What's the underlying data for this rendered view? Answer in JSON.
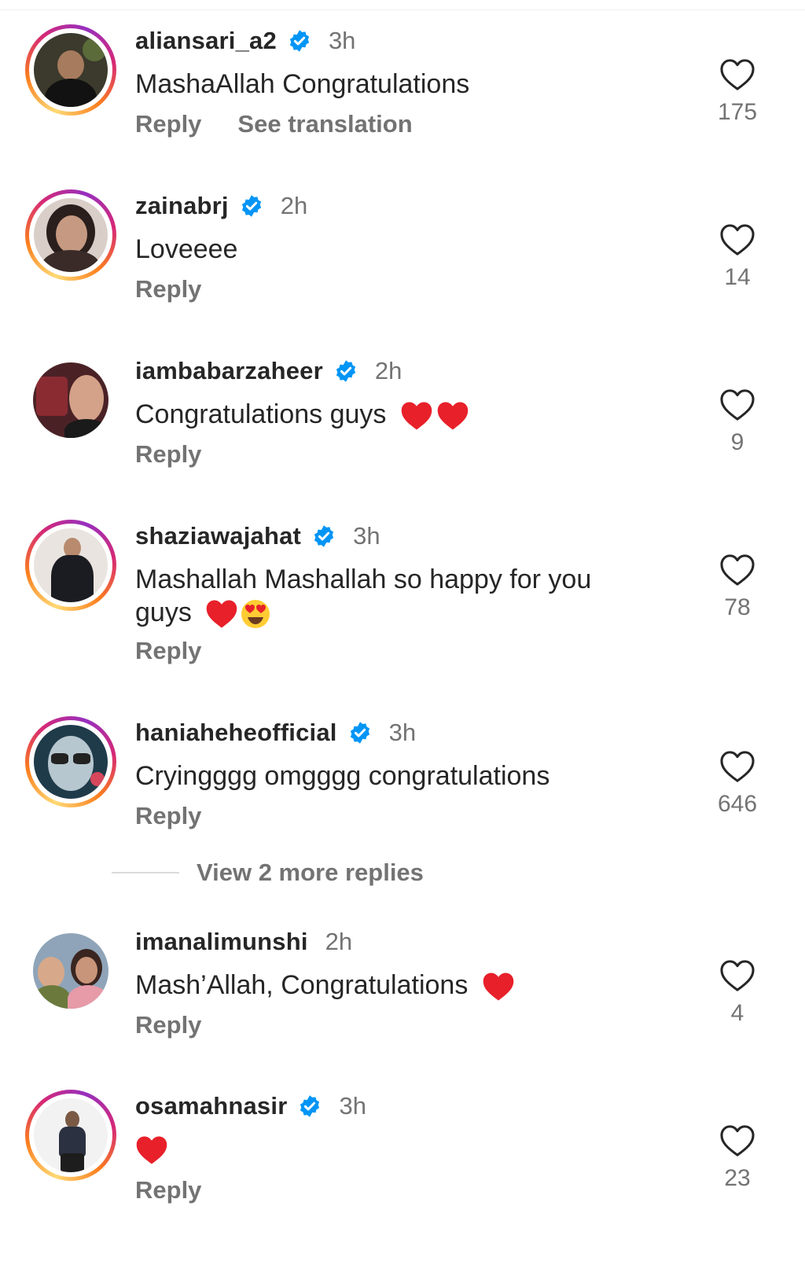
{
  "comments": [
    {
      "username": "aliansari_a2",
      "verified": true,
      "time": "3h",
      "text": "MashaAllah Congratulations",
      "emojis": [],
      "reply_label": "Reply",
      "translate_label": "See translation",
      "likes": "175",
      "story": true
    },
    {
      "username": "zainabrj",
      "verified": true,
      "time": "2h",
      "text": "Loveeee",
      "emojis": [],
      "reply_label": "Reply",
      "likes": "14",
      "story": true
    },
    {
      "username": "iambabarzaheer",
      "verified": true,
      "time": "2h",
      "text": "Congratulations guys",
      "emojis": [
        "red-heart",
        "red-heart"
      ],
      "reply_label": "Reply",
      "likes": "9",
      "story": false
    },
    {
      "username": "shaziawajahat",
      "verified": true,
      "time": "3h",
      "text_line1": "Mashallah Mashallah so happy for you",
      "text_line2": "guys",
      "emojis": [
        "red-heart",
        "heart-eyes"
      ],
      "reply_label": "Reply",
      "likes": "78",
      "story": true
    },
    {
      "username": "haniaheheofficial",
      "verified": true,
      "time": "3h",
      "text": "Cryingggg omgggg congratulations",
      "emojis": [],
      "reply_label": "Reply",
      "likes": "646",
      "story": true
    },
    {
      "username": "imanalimunshi",
      "verified": false,
      "time": "2h",
      "text": "Mash’Allah, Congratulations",
      "emojis": [
        "red-heart"
      ],
      "reply_label": "Reply",
      "likes": "4",
      "story": false
    },
    {
      "username": "osamahnasir",
      "verified": true,
      "time": "3h",
      "text": "",
      "emojis": [
        "red-heart"
      ],
      "reply_label": "Reply",
      "likes": "23",
      "story": true
    }
  ],
  "view_more_replies": "View 2 more replies",
  "colors": {
    "verified": "#0095f6",
    "muted": "#737373",
    "text": "#262626",
    "heart": "#e8202a"
  },
  "icons": {
    "like": "heart-outline-icon",
    "verified": "verified-badge-icon"
  }
}
